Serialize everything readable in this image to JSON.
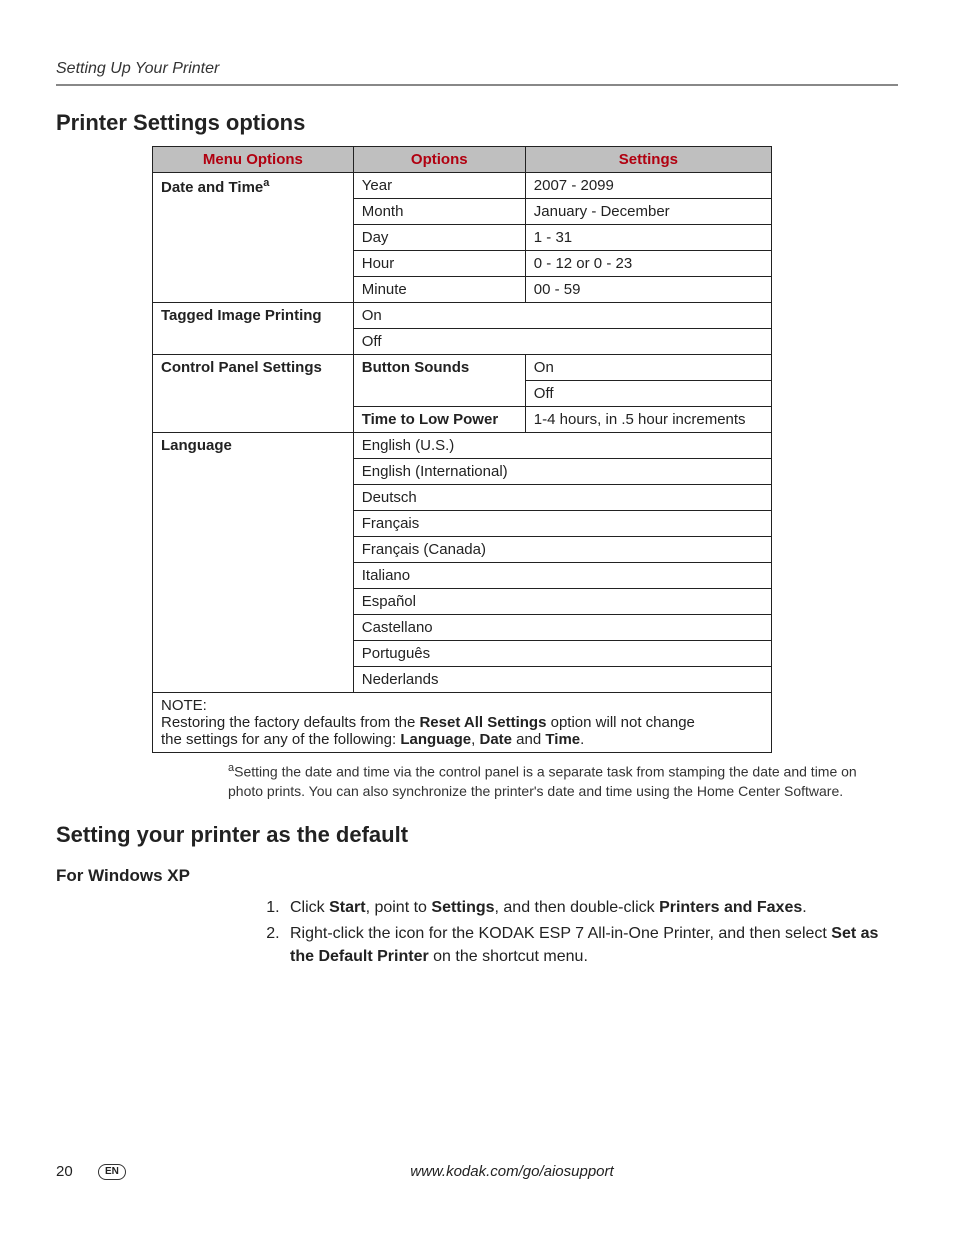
{
  "running_head": "Setting Up Your Printer",
  "section1_title": "Printer Settings options",
  "table": {
    "headers": [
      "Menu Options",
      "Options",
      "Settings"
    ],
    "date_time_label": "Date and Time",
    "date_time_sup": "a",
    "date_time_rows": [
      {
        "option": "Year",
        "setting": "2007 - 2099"
      },
      {
        "option": "Month",
        "setting": "January - December"
      },
      {
        "option": "Day",
        "setting": "1 - 31"
      },
      {
        "option": "Hour",
        "setting": "0 - 12 or 0 - 23"
      },
      {
        "option": "Minute",
        "setting": "00 - 59"
      }
    ],
    "tagged_label": "Tagged Image Printing",
    "tagged_rows": [
      "On",
      "Off"
    ],
    "cps_label": "Control Panel Settings",
    "cps_button_sounds_label": "Button Sounds",
    "cps_button_sounds_rows": [
      "On",
      "Off"
    ],
    "cps_time_low_label": "Time to Low Power",
    "cps_time_low_value": "1-4 hours, in .5 hour increments",
    "language_label": "Language",
    "language_rows": [
      "English (U.S.)",
      "English (International)",
      "Deutsch",
      "Français",
      "Français (Canada)",
      "Italiano",
      "Español",
      "Castellano",
      "Português",
      "Nederlands"
    ],
    "note_label": "NOTE:",
    "note_pre": "Restoring the factory defaults from the ",
    "note_bold1": "Reset All Settings",
    "note_mid": " option will not change the settings for any of the following: ",
    "note_bold2": "Language",
    "note_sep1": ", ",
    "note_bold3": "Date",
    "note_sep2": " and ",
    "note_bold4": "Time",
    "note_end": "."
  },
  "footnote": {
    "marker": "a",
    "text": "Setting the date and time via the control panel is a separate task from stamping the date and time on photo prints. You can also synchronize the printer's date and time using the Home Center Software."
  },
  "section2_title": "Setting your printer as the default",
  "xp_heading": "For Windows XP",
  "steps": {
    "s1_pre": "Click ",
    "s1_b1": "Start",
    "s1_mid1": ", point to ",
    "s1_b2": "Settings",
    "s1_mid2": ", and then double-click ",
    "s1_b3": "Printers and Faxes",
    "s1_end": ".",
    "s2_pre": "Right-click the icon for the KODAK ESP 7 All-in-One Printer, and then select ",
    "s2_b1": "Set as the Default Printer",
    "s2_end": " on the shortcut menu."
  },
  "footer": {
    "page": "20",
    "lang": "EN",
    "url": "www.kodak.com/go/aiosupport"
  }
}
